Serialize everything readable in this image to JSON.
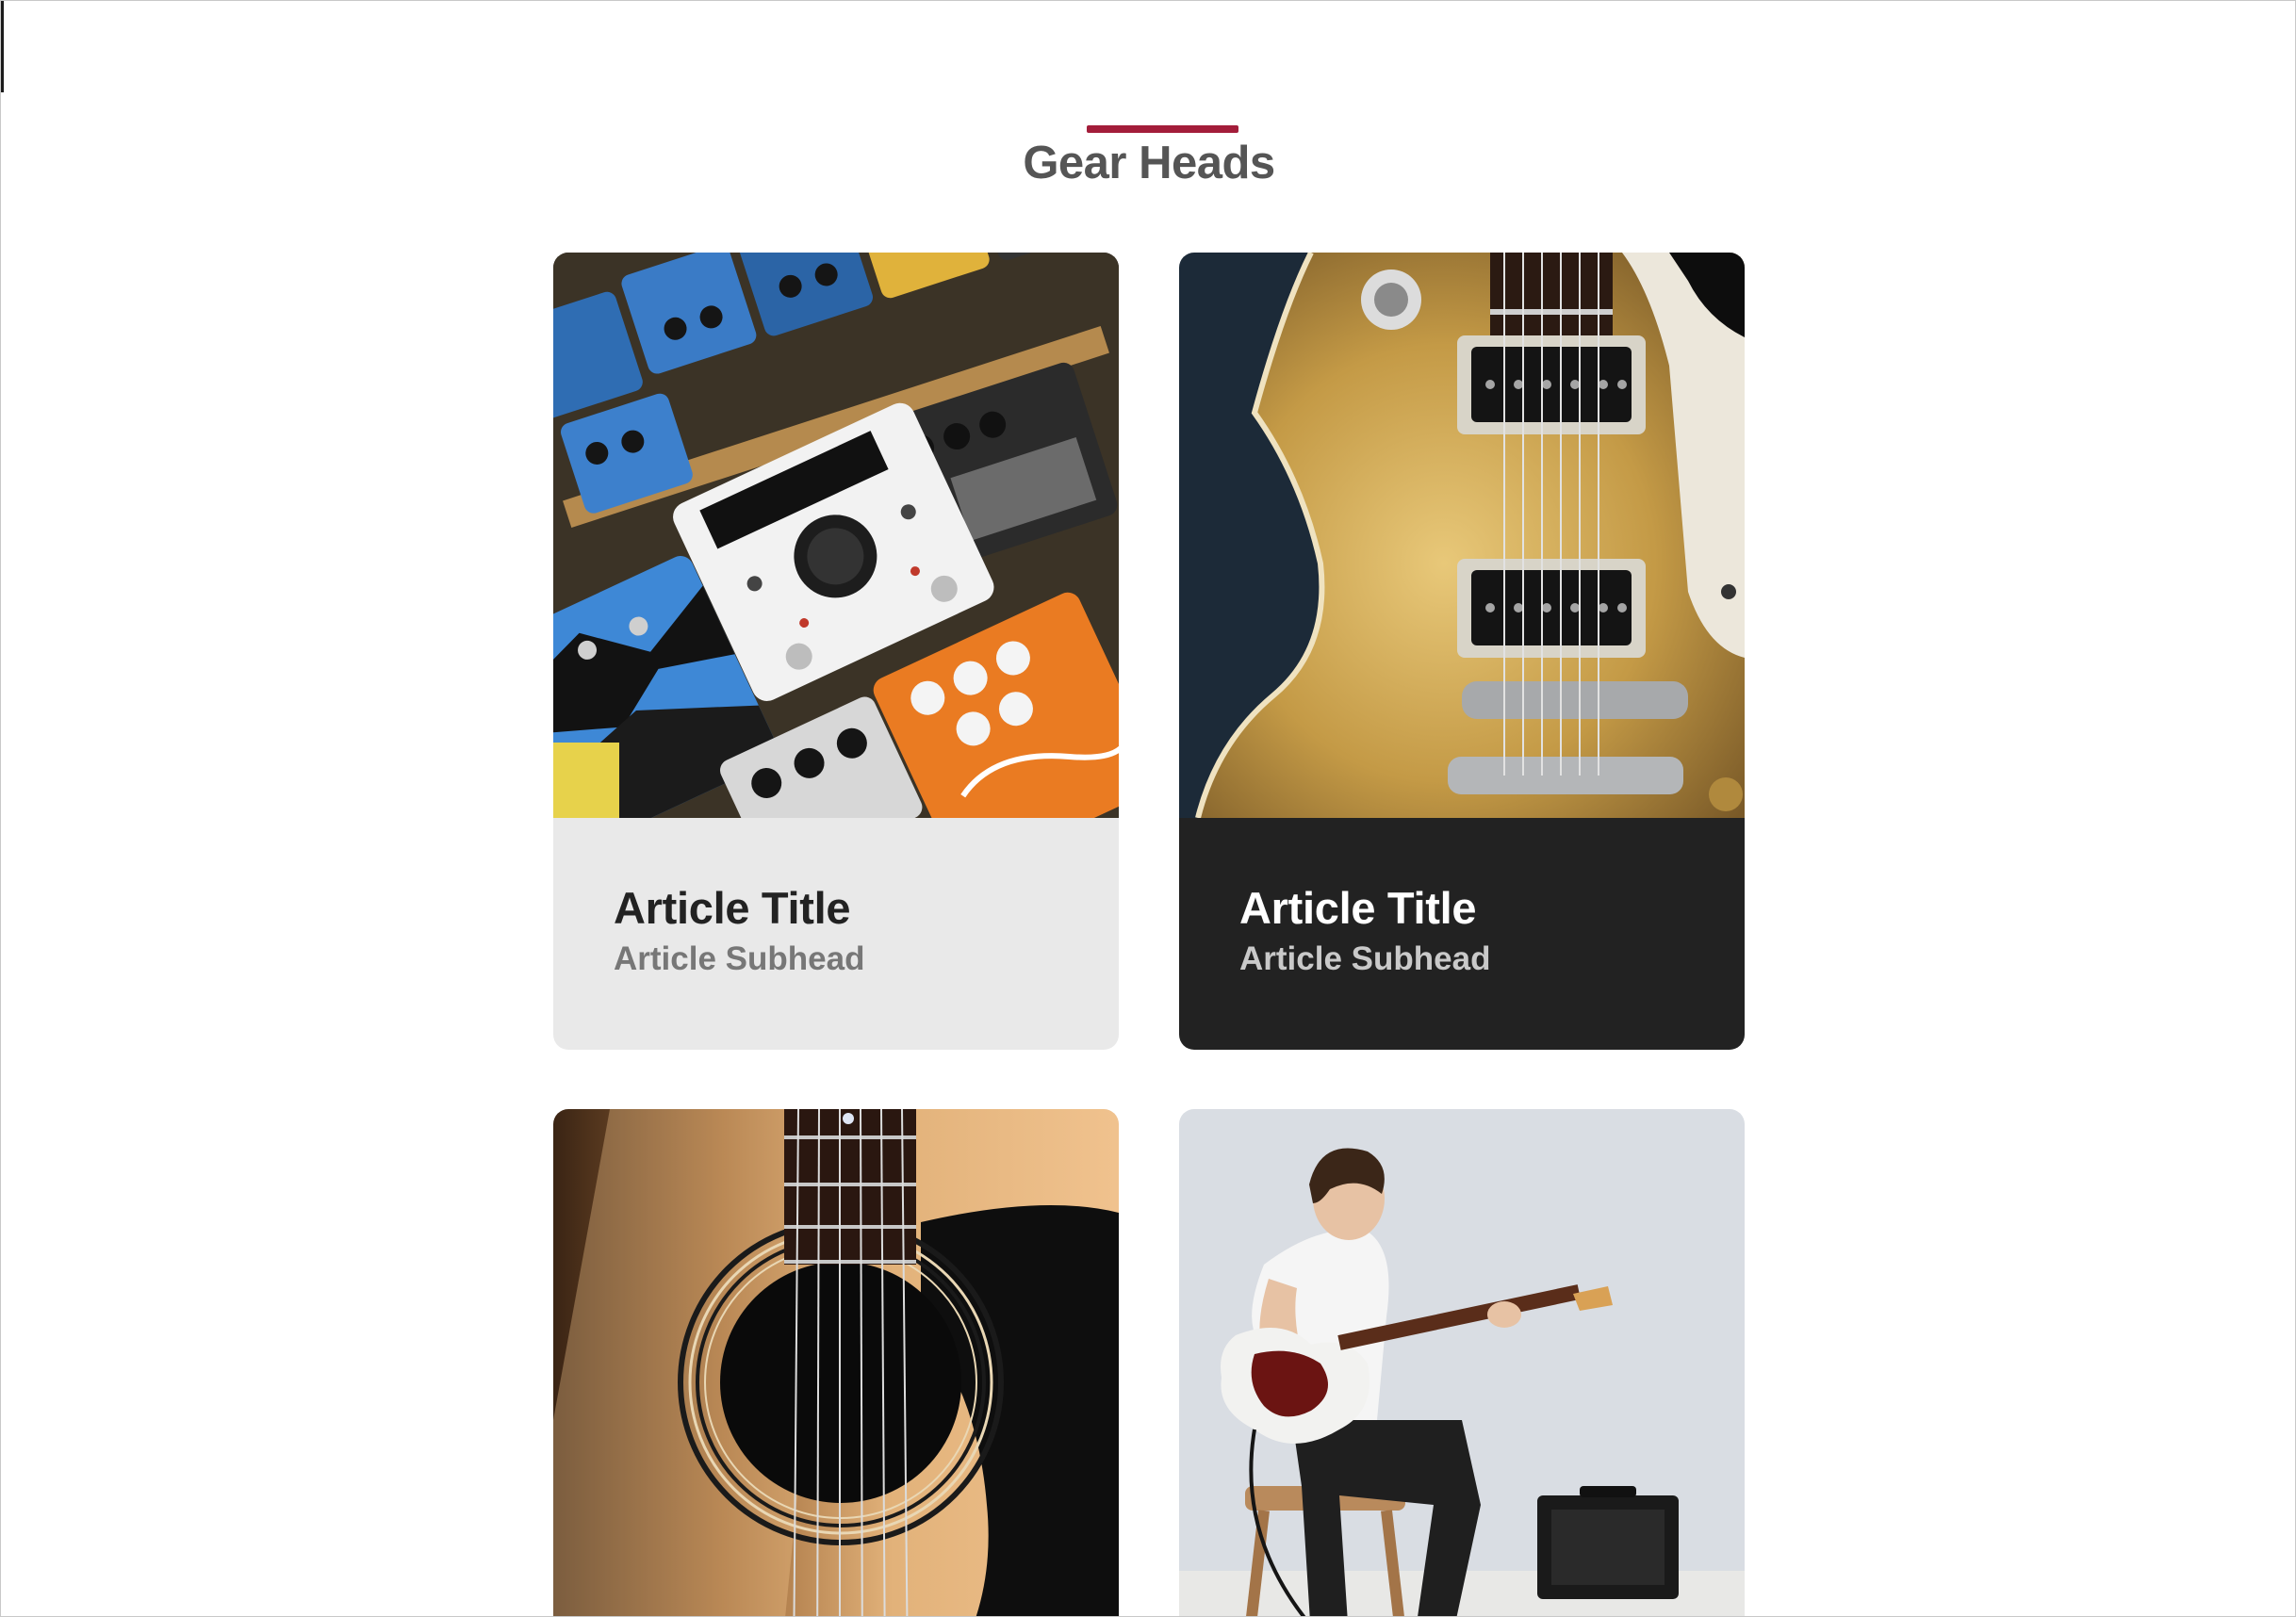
{
  "section": {
    "title": "Gear Heads",
    "accent_color": "#a31d3a"
  },
  "cards": [
    {
      "image_subject": "pedals-photo",
      "title": "Article Title",
      "subhead": "Article Subhead",
      "theme": "light"
    },
    {
      "image_subject": "electric-guitar-body-photo",
      "title": "Article Title",
      "subhead": "Article Subhead",
      "theme": "dark"
    },
    {
      "image_subject": "acoustic-guitar-soundhole-photo"
    },
    {
      "image_subject": "guitarist-seated-photo"
    }
  ]
}
